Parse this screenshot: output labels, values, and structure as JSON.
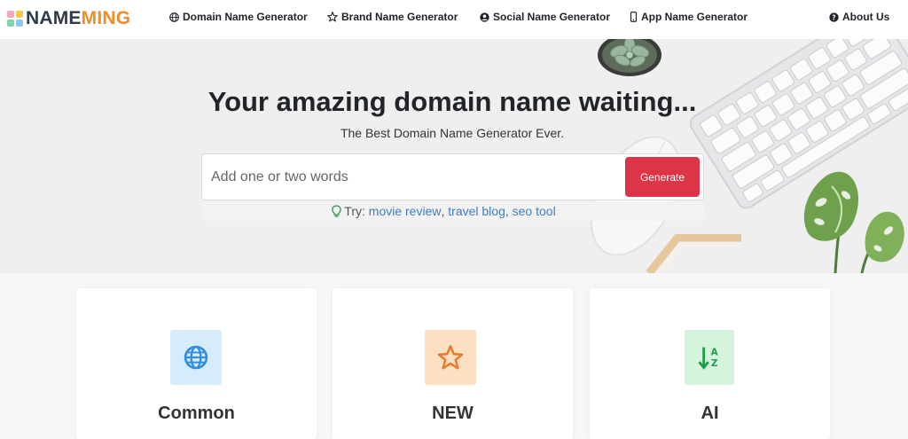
{
  "logo": {
    "part1": "NAME",
    "part2": "MING",
    "tile_colors": [
      "#f4a7b9",
      "#f7c948",
      "#7ed6a7",
      "#8ec5f4"
    ]
  },
  "nav": {
    "items": [
      {
        "label": "Domain Name Generator",
        "icon": "globe-icon"
      },
      {
        "label": "Brand Name Generator",
        "icon": "star-icon"
      },
      {
        "label": "Social Name Generator",
        "icon": "user-circle-icon"
      },
      {
        "label": "App Name Generator",
        "icon": "mobile-icon"
      },
      {
        "label": "About Us",
        "icon": "question-circle-icon"
      }
    ]
  },
  "hero": {
    "title": "Your amazing domain name waiting...",
    "subtitle": "The Best Domain Name Generator Ever.",
    "search_placeholder": "Add one or two words",
    "button_label": "Generate",
    "try_label": "Try:",
    "suggestions": [
      "movie review",
      "travel blog",
      "seo tool"
    ],
    "separator": ","
  },
  "cards": [
    {
      "title": "Common",
      "icon": "globe-icon",
      "icon_bg": "#d6ecfb",
      "icon_color": "#2f8ee0"
    },
    {
      "title": "NEW",
      "icon": "star-icon",
      "icon_bg": "#fde0c2",
      "icon_color": "#e8792b"
    },
    {
      "title": "AI",
      "icon": "sort-alpha-icon",
      "icon_bg": "#d4f4dd",
      "icon_color": "#1f9d4a"
    }
  ],
  "colors": {
    "accent": "#dc3545",
    "link": "#3d7fc4",
    "logo_dark": "#2f3a4a",
    "logo_orange": "#f28c28"
  }
}
